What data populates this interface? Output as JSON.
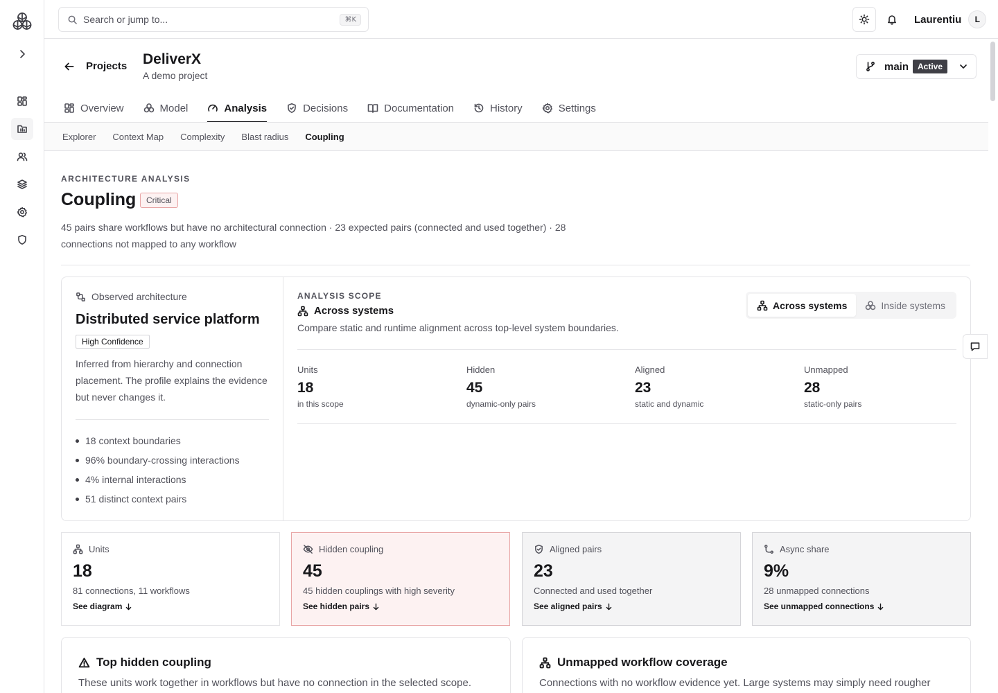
{
  "topbar": {
    "search_placeholder": "Search or jump to...",
    "search_shortcut": "⌘K",
    "user_name": "Laurentiu",
    "user_initial": "L"
  },
  "project": {
    "back_label": "Projects",
    "title": "DeliverX",
    "subtitle": "A demo project",
    "branch": "main",
    "branch_status": "Active"
  },
  "tabs": [
    {
      "label": "Overview",
      "icon": "dashboard-icon"
    },
    {
      "label": "Model",
      "icon": "boxes-icon"
    },
    {
      "label": "Analysis",
      "icon": "gauge-icon",
      "active": true
    },
    {
      "label": "Decisions",
      "icon": "shield-check-icon"
    },
    {
      "label": "Documentation",
      "icon": "book-icon"
    },
    {
      "label": "History",
      "icon": "history-icon"
    },
    {
      "label": "Settings",
      "icon": "gear-icon"
    }
  ],
  "subtabs": [
    {
      "label": "Explorer"
    },
    {
      "label": "Context Map"
    },
    {
      "label": "Complexity"
    },
    {
      "label": "Blast radius"
    },
    {
      "label": "Coupling",
      "active": true
    }
  ],
  "analysis": {
    "eyebrow": "ARCHITECTURE ANALYSIS",
    "title": "Coupling",
    "severity": "Critical",
    "summary": "45 pairs share workflows but have no architectural connection · 23 expected pairs (connected and used together) · 28 connections not mapped to any workflow"
  },
  "observed": {
    "label": "Observed architecture",
    "title": "Distributed service platform",
    "confidence": "High Confidence",
    "description": "Inferred from hierarchy and connection placement. The profile explains the evidence but never changes it.",
    "bullets": [
      "18 context boundaries",
      "96% boundary-crossing interactions",
      "4% internal interactions",
      "51 distinct context pairs"
    ]
  },
  "scope": {
    "eyebrow": "ANALYSIS SCOPE",
    "title": "Across systems",
    "description": "Compare static and runtime alignment across top-level system boundaries.",
    "toggle_on": "Across systems",
    "toggle_off": "Inside systems",
    "stats": [
      {
        "label": "Units",
        "value": "18",
        "sub": "in this scope"
      },
      {
        "label": "Hidden",
        "value": "45",
        "sub": "dynamic-only pairs"
      },
      {
        "label": "Aligned",
        "value": "23",
        "sub": "static and dynamic"
      },
      {
        "label": "Unmapped",
        "value": "28",
        "sub": "static-only pairs"
      }
    ]
  },
  "cards": [
    {
      "label": "Units",
      "value": "18",
      "sub": "81 connections, 11 workflows",
      "link": "See diagram",
      "icon": "hierarchy-icon"
    },
    {
      "label": "Hidden coupling",
      "value": "45",
      "sub": "45 hidden couplings with high severity",
      "link": "See hidden pairs",
      "icon": "eye-off-icon"
    },
    {
      "label": "Aligned pairs",
      "value": "23",
      "sub": "Connected and used together",
      "link": "See aligned pairs",
      "icon": "shield-check-icon"
    },
    {
      "label": "Async share",
      "value": "9%",
      "sub": "28 unmapped connections",
      "link": "See unmapped connections",
      "icon": "route-icon"
    }
  ],
  "bottom": {
    "hidden_title": "Top hidden coupling",
    "hidden_desc": "These units work together in workflows but have no connection in the selected scope.",
    "unmapped_title": "Unmapped workflow coverage",
    "unmapped_desc": "Connections with no workflow evidence yet. Large systems may simply need rougher"
  },
  "colors": {
    "accent_dark": "#18181b",
    "critical_bg": "#fdf2f2",
    "critical_border": "#e8a5a5",
    "muted_text": "#52525b",
    "border": "#e4e4e7"
  }
}
